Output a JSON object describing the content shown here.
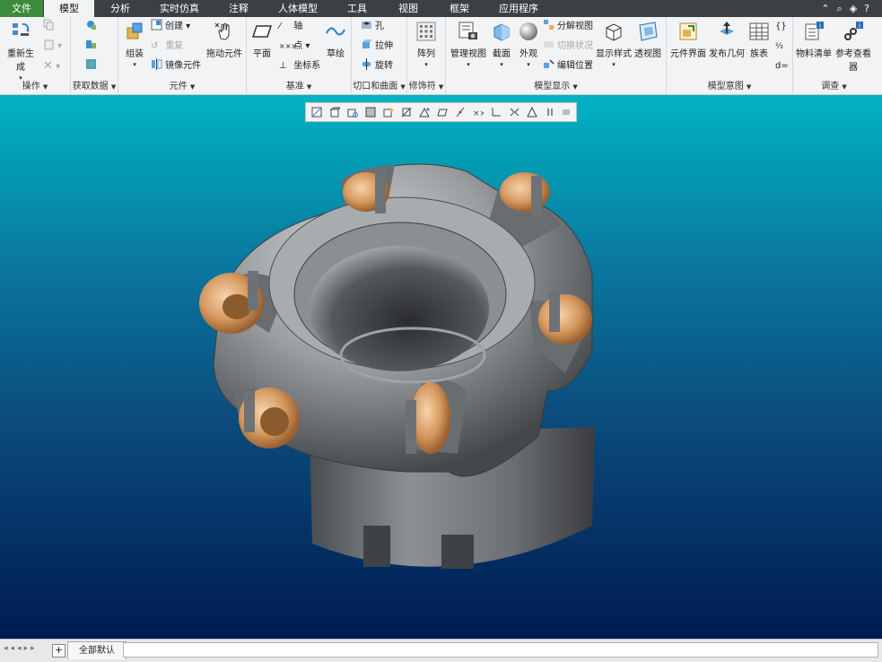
{
  "tabs": [
    "文件",
    "模型",
    "分析",
    "实时仿真",
    "注释",
    "人体模型",
    "工具",
    "视图",
    "框架",
    "应用程序"
  ],
  "active_tab": "模型",
  "groups": {
    "operations": {
      "title": "操作",
      "regenerate": "重新生成"
    },
    "get_data": {
      "title": "获取数据"
    },
    "component": {
      "title": "元件",
      "assemble": "组装",
      "create": "创建",
      "repeat": "重复",
      "mirror": "镜像元件",
      "drag": "拖动元件"
    },
    "datum": {
      "title": "基准",
      "plane": "平面",
      "axis": "轴",
      "point": "点",
      "csys": "坐标系",
      "sketch": "草绘"
    },
    "cut": {
      "title": "切口和曲面",
      "hole": "孔",
      "extrude": "拉伸",
      "revolve": "旋转"
    },
    "modifiers": {
      "title": "修饰符",
      "pattern": "阵列"
    },
    "model_display": {
      "title": "模型显示",
      "manage_views": "管理视图",
      "section": "截面",
      "appearance": "外观",
      "exploded": "分解视图",
      "toggle_status": "切换状况",
      "edit_position": "编辑位置",
      "display_style": "显示样式",
      "perspective": "透视图"
    },
    "model_intent": {
      "title": "模型意图",
      "component_interface": "元件界面",
      "publish_geometry": "发布几何",
      "family_table": "族表"
    },
    "investigate": {
      "title": "调查",
      "bom": "物料清单",
      "reference_viewer": "参考查看器"
    }
  },
  "statusbar": {
    "tab": "全部默认"
  },
  "colors": {
    "accent": "#3c8b3c",
    "menubar": "#3b4045",
    "part_body": "#8f9296",
    "inserts": "#c98a52"
  }
}
